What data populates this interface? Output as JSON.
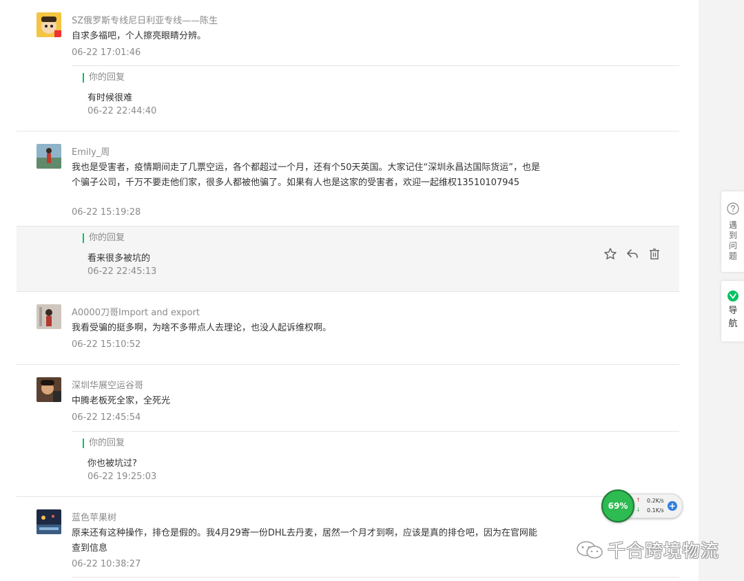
{
  "comments": [
    {
      "nickname": "SZ俄罗斯专线尼日利亚专线——陈生",
      "text": "自求多福吧，个人擦亮眼睛分辨。",
      "time": "06-22 17:01:46",
      "reply": {
        "label": "你的回复",
        "text": "有时候很难",
        "time": "06-22 22:44:40"
      }
    },
    {
      "nickname": "Emily_周",
      "text": "我也是受害者，疫情期间走了几票空运，各个都超过一个月，还有个50天英国。大家记住“深圳永昌达国际货运”，也是个骗子公司，千万不要走他们家，很多人都被他骗了。如果有人也是这家的受害者，欢迎一起维权13510107945",
      "time": "06-22 15:19:28",
      "reply": {
        "label": "你的回复",
        "text": "看来很多被坑的",
        "time": "06-22 22:45:13"
      }
    },
    {
      "nickname": "A0000刀哥Import and export",
      "text": "我看受骗的挺多啊，为啥不多带点人去理论，也没人起诉维权啊。",
      "time": "06-22 15:10:52"
    },
    {
      "nickname": "深圳华展空运谷哥",
      "text": "中腾老板死全家，全死光",
      "time": "06-22 12:45:54",
      "reply": {
        "label": "你的回复",
        "text": "你也被坑过?",
        "time": "06-22 19:25:03"
      }
    },
    {
      "nickname": "蓝色苹果树",
      "text": "原来还有这种操作，排仓是假的。我4月29寄一份DHL去丹麦，居然一个月才到啊，应该是真的排仓吧，因为在官网能查到信息",
      "time": "06-22 10:38:27"
    }
  ],
  "actions": {
    "star_icon": "star-icon",
    "reply_icon": "reply-icon",
    "delete_icon": "trash-icon"
  },
  "side": {
    "help_label": "遇到问题",
    "nav_label": "导航"
  },
  "speed_widget": {
    "percent": "69%",
    "up": "0.2K/s",
    "down": "0.1K/s",
    "up_arrow": "↑",
    "down_arrow": "↓",
    "plus": "+"
  },
  "watermark": {
    "text": "千合跨境物流"
  },
  "colors": {
    "accent": "#07c160",
    "muted": "#8a8a8a",
    "text": "#333333"
  }
}
